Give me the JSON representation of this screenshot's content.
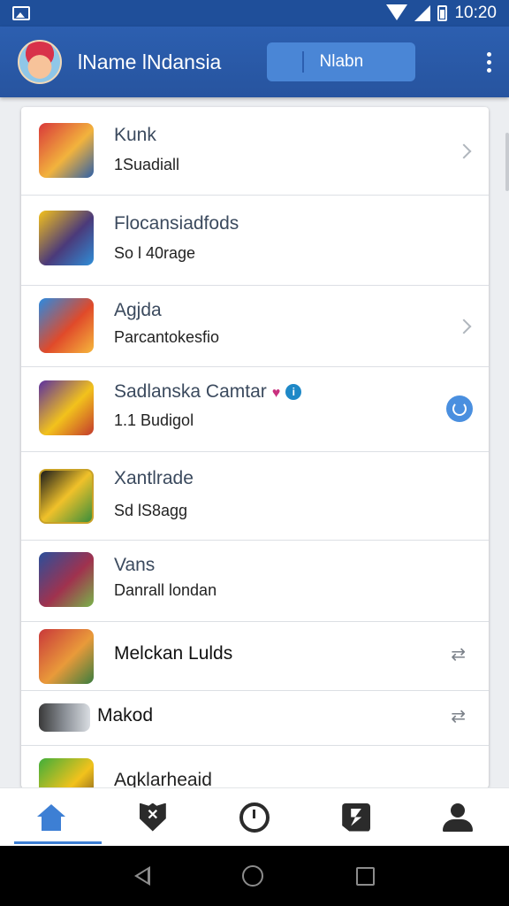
{
  "status_bar": {
    "time": "10:20"
  },
  "app_bar": {
    "title": "lName lNdansia",
    "button_label": "Nlabn"
  },
  "list": [
    {
      "title": "Kunk",
      "subtitle": "1Suadiall",
      "trailing": "chevron-right-icon",
      "icon_colors": [
        "#d9383a",
        "#2d5fa8",
        "#f2b33d"
      ]
    },
    {
      "title": "Flocansiadfods",
      "subtitle": "So l 40rage",
      "trailing": "none",
      "icon_colors": [
        "#f4c21c",
        "#4b3a7a",
        "#2f8ed8"
      ]
    },
    {
      "title": "Agjda",
      "subtitle": "Parcantokesfio",
      "trailing": "chevron-right-icon",
      "icon_colors": [
        "#2a8ae2",
        "#e04a2a",
        "#f6b73c"
      ]
    },
    {
      "title": "Sadlanska Camtar",
      "subtitle": "1.1 Budigol",
      "trailing": "status-dot",
      "badges": [
        "heart-icon",
        "info-icon"
      ],
      "icon_colors": [
        "#5b2fa0",
        "#f2c21c",
        "#c33a2c"
      ]
    },
    {
      "title": "Xantlrade",
      "subtitle": "Sd lS8agg",
      "trailing": "none",
      "icon_colors": [
        "#1b1b1b",
        "#f0c12a",
        "#3a8e3b"
      ]
    },
    {
      "title": "Vans",
      "subtitle": "Danrall londan",
      "trailing": "none",
      "icon_colors": [
        "#2a4f9c",
        "#a0324e",
        "#79b44a"
      ]
    },
    {
      "title": "Melckan Lulds",
      "subtitle": "",
      "trailing": "swap-arrows-icon",
      "icon_colors": [
        "#c9383a",
        "#e99a3a",
        "#3a7d3f"
      ]
    },
    {
      "title": "Makod",
      "subtitle": "",
      "trailing": "swap-arrows-icon",
      "icon_colors": [
        "#3a3a3a",
        "#8a8f96",
        "#d9dde2"
      ]
    },
    {
      "title": "Aqklarheaid",
      "subtitle": "",
      "trailing": "none",
      "icon_colors": [
        "#3fae3a",
        "#f2c21c",
        "#5a3a20"
      ]
    }
  ],
  "bottom_nav": [
    {
      "icon": "home-icon",
      "active": true
    },
    {
      "icon": "shield-x-icon",
      "active": false
    },
    {
      "icon": "clock-icon",
      "active": false
    },
    {
      "icon": "bolt-icon",
      "active": false
    },
    {
      "icon": "person-icon",
      "active": false
    }
  ],
  "colors": {
    "primary": "#2c5fb0",
    "accent": "#3d7fd4",
    "button": "#4a86d6"
  }
}
